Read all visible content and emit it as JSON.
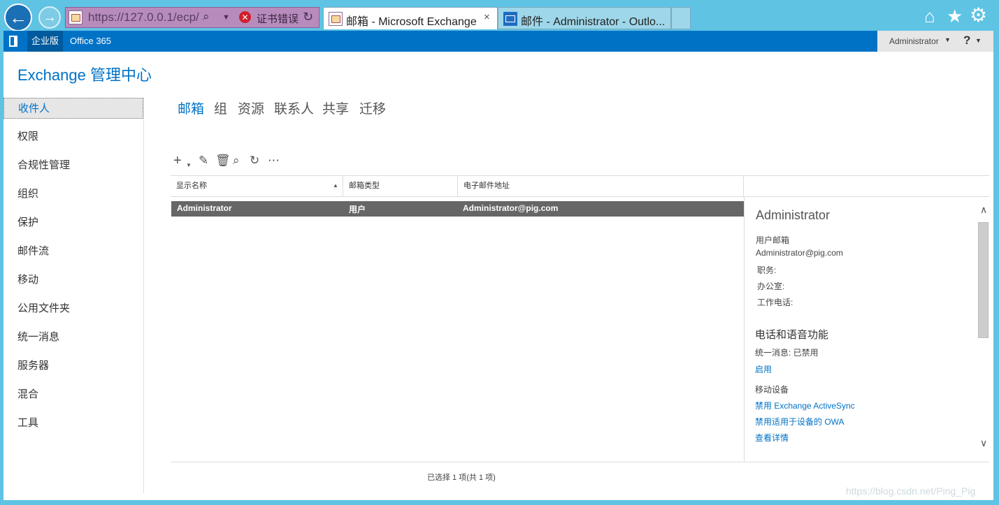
{
  "browser": {
    "url": "https://127.0.0.1/ecp/",
    "cert_error": "证书错误",
    "tabs": [
      {
        "title": "邮箱 - Microsoft Exchange"
      },
      {
        "title": "邮件 - Administrator - Outlo..."
      }
    ],
    "close_glyph": "×"
  },
  "topbar": {
    "nav_enterprise": "企业版",
    "nav_office365": "Office 365",
    "user": "Administrator",
    "help": "?"
  },
  "app_title": "Exchange 管理中心",
  "sidebar": {
    "items": [
      {
        "label": "收件人"
      },
      {
        "label": "权限"
      },
      {
        "label": "合规性管理"
      },
      {
        "label": "组织"
      },
      {
        "label": "保护"
      },
      {
        "label": "邮件流"
      },
      {
        "label": "移动"
      },
      {
        "label": "公用文件夹"
      },
      {
        "label": "统一消息"
      },
      {
        "label": "服务器"
      },
      {
        "label": "混合"
      },
      {
        "label": "工具"
      }
    ]
  },
  "subtabs": [
    {
      "label": "邮箱"
    },
    {
      "label": "组"
    },
    {
      "label": "资源"
    },
    {
      "label": "联系人"
    },
    {
      "label": "共享"
    },
    {
      "label": "迁移"
    }
  ],
  "toolbar": {
    "add_icon": "add-icon",
    "edit_icon": "pencil-icon",
    "delete_icon": "trash-icon",
    "search_icon": "search-icon",
    "refresh_icon": "refresh-icon",
    "more_icon": "more-icon"
  },
  "grid": {
    "columns": [
      "显示名称",
      "邮箱类型",
      "电子邮件地址"
    ],
    "rows": [
      {
        "display_name": "Administrator",
        "mailbox_type": "用户",
        "email": "Administrator@pig.com"
      }
    ]
  },
  "details": {
    "name": "Administrator",
    "type_label": "用户邮箱",
    "email": "Administrator@pig.com",
    "title_label": "职务:",
    "office_label": "办公室:",
    "work_phone_label": "工作电话:",
    "voice_heading": "电话和语音功能",
    "um_status": "统一消息:  已禁用",
    "enable_link": "启用",
    "mobile_heading": "移动设备",
    "disable_activesync": "禁用 Exchange ActiveSync",
    "disable_owa": "禁用适用于设备的 OWA",
    "view_details": "查看详情"
  },
  "status": "已选择 1 项(共 1 项)",
  "watermark": "https://blog.csdn.net/Ping_Pig",
  "colors": {
    "accent": "#0072c6",
    "chrome_bg": "#5fc3e4",
    "selected_row": "#666666"
  }
}
